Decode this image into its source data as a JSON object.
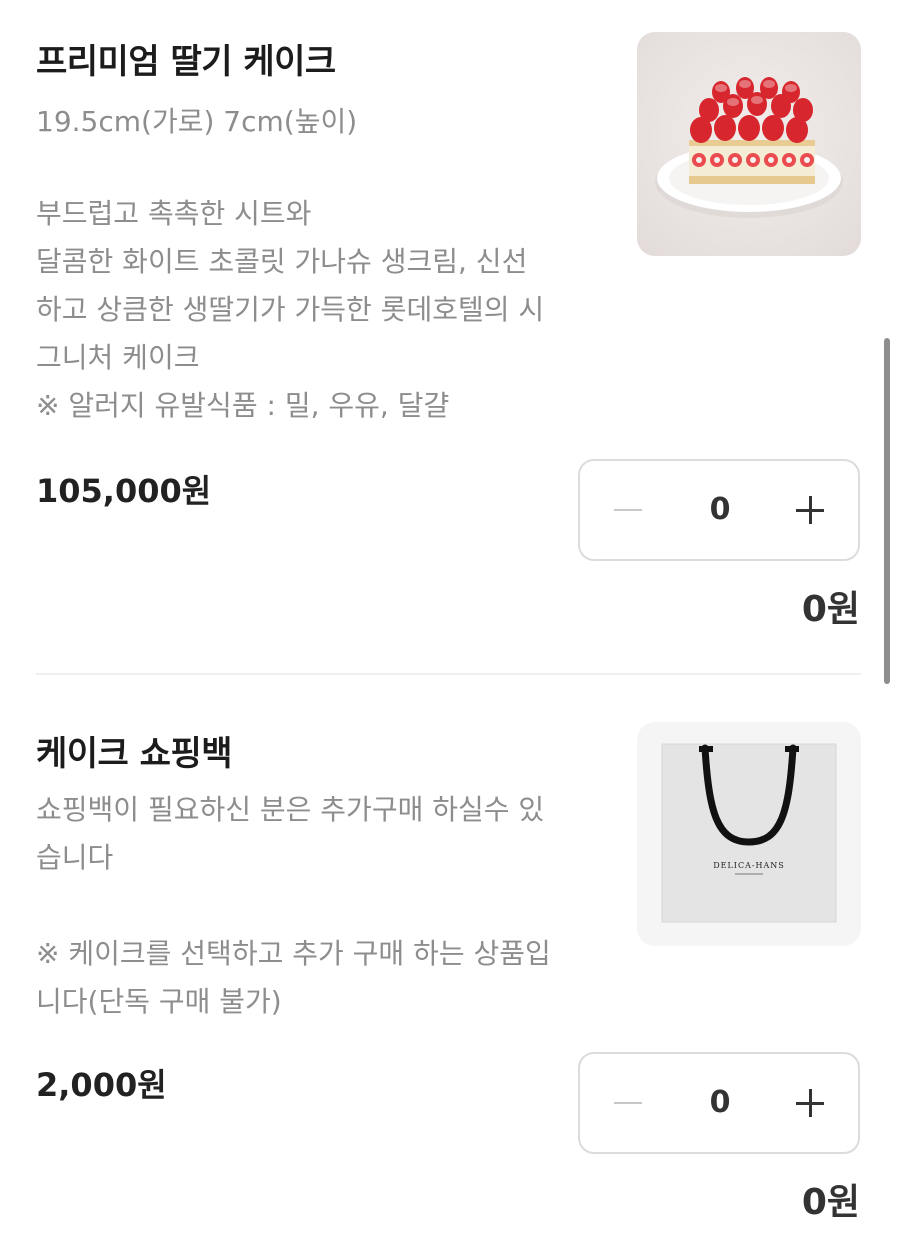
{
  "products": [
    {
      "title": "프리미엄 딸기 케이크",
      "size": "19.5cm(가로) 7cm(높이)",
      "description_lines": [
        "부드럽고 촉촉한 시트와",
        "달콤한 화이트 초콜릿 가나슈 생크림, 신선",
        "하고 상큼한 생딸기가 가득한 롯데호텔의 시",
        "그니처 케이크",
        "※ 알러지 유발식품 : 밀, 우유, 달걀"
      ],
      "price": "105,000원",
      "quantity": "0",
      "total": "0원",
      "image": "strawberry-cake-photo"
    },
    {
      "title": "케이크 쇼핑백",
      "description_lines": [
        "쇼핑백이 필요하신 분은 추가구매 하실수 있",
        "습니다",
        "",
        "※ 케이크를 선택하고 추가 구매 하는 상품입",
        "니다(단독 구매 불가)"
      ],
      "price": "2,000원",
      "quantity": "0",
      "total": "0원",
      "image": "shopping-bag-photo",
      "bag_brand": "DELICA-HANS"
    }
  ],
  "stepper": {
    "minus_icon": "minus-icon",
    "plus_icon": "plus-icon"
  }
}
